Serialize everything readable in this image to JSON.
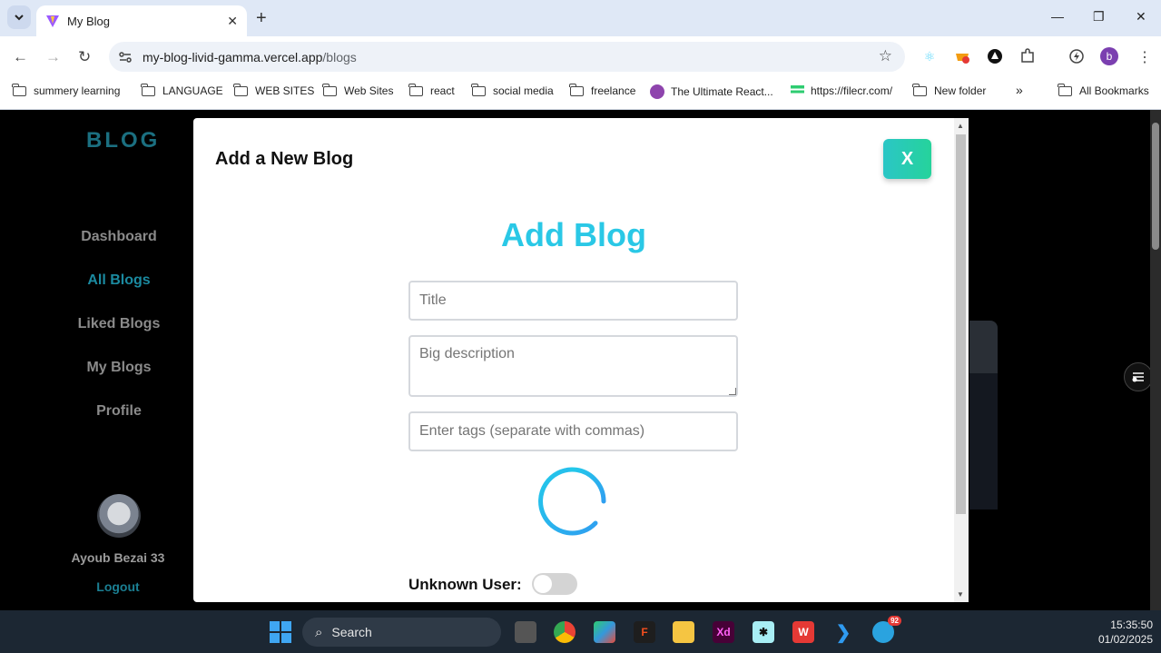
{
  "browser": {
    "tab_title": "My Blog",
    "tab_close": "✕",
    "new_tab": "+",
    "window_controls": {
      "minimize": "—",
      "restore": "❐",
      "close": "✕"
    },
    "url_domain": "my-blog-livid-gamma.vercel.app",
    "url_path": "/blogs",
    "profile_initial": "b",
    "bookmarks": [
      {
        "label": "summery learning",
        "type": "folder"
      },
      {
        "label": "LANGUAGE",
        "type": "folder"
      },
      {
        "label": "WEB SITES",
        "type": "folder"
      },
      {
        "label": "Web Sites",
        "type": "folder"
      },
      {
        "label": "react",
        "type": "folder"
      },
      {
        "label": "social media",
        "type": "folder"
      },
      {
        "label": "freelance",
        "type": "folder"
      },
      {
        "label": "The Ultimate React...",
        "type": "link"
      },
      {
        "label": "https://filecr.com/",
        "type": "link"
      },
      {
        "label": "New folder",
        "type": "folder"
      }
    ],
    "bookmarks_overflow": "»",
    "all_bookmarks": "All Bookmarks"
  },
  "sidebar": {
    "logo": "BLOG",
    "items": [
      {
        "label": "Dashboard",
        "active": false
      },
      {
        "label": "All Blogs",
        "active": true
      },
      {
        "label": "Liked Blogs",
        "active": false
      },
      {
        "label": "My Blogs",
        "active": false
      },
      {
        "label": "Profile",
        "active": false
      }
    ],
    "user_name": "Ayoub Bezai 33",
    "logout_label": "Logout"
  },
  "modal": {
    "header": "Add a New Blog",
    "close_label": "X",
    "form_title": "Add Blog",
    "title_placeholder": "Title",
    "description_placeholder": "Big description",
    "tags_placeholder": "Enter tags (separate with commas)",
    "toggle_label": "Unknown User:",
    "toggle_on": false
  },
  "taskbar": {
    "search_placeholder": "Search",
    "time": "15:35:50",
    "date": "01/02/2025",
    "telegram_badge": "92"
  },
  "colors": {
    "accent": "#2ac8e6",
    "sidebar_active": "#1b8aa0",
    "close_button_start": "#2bc6c6",
    "close_button_end": "#25d39b"
  }
}
